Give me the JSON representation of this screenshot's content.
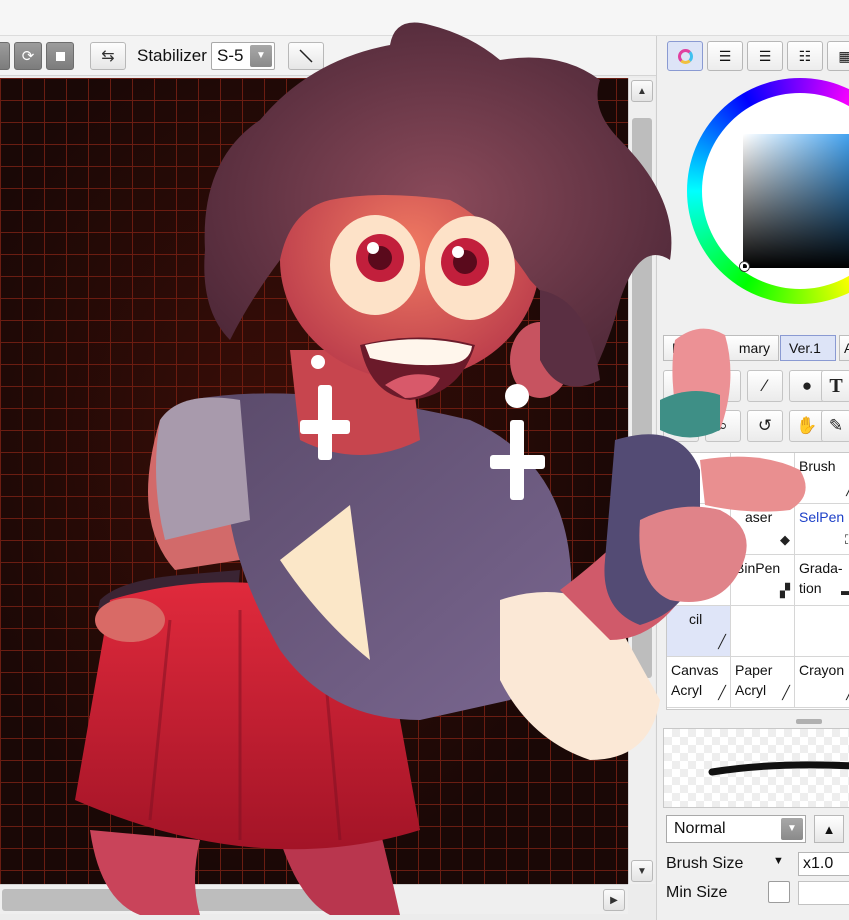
{
  "toolbar": {
    "stabilizer_label": "Stabilizer",
    "stabilizer_value": "S-5"
  },
  "color_panel": {
    "tabs": [
      "color-wheel",
      "sliders",
      "rgb",
      "palette",
      "swatches"
    ]
  },
  "brush_tabs": {
    "items": [
      {
        "label": "B",
        "active": false
      },
      {
        "label": "mary",
        "active": false
      },
      {
        "label": "Ver.1",
        "active": true
      },
      {
        "label": "A",
        "active": false
      }
    ]
  },
  "tools": {
    "icons": [
      "cloud-icon",
      "magic-wand-icon",
      "bucket-icon",
      "text-icon",
      "magnifier-icon",
      "rotate-icon",
      "hand-icon",
      "eyedropper-icon"
    ],
    "text_tool_glyph": "T"
  },
  "brushes": {
    "brush": "Brush",
    "eraser": "aser",
    "selpen": "SelPen",
    "binpen": "BinPen",
    "gradation_1": "Grada-",
    "gradation_2": "tion",
    "pencil": "cil",
    "canvas_1": "Canvas",
    "canvas_2": "Acryl",
    "paper_1": "Paper",
    "paper_2": "Acryl",
    "crayon": "Crayon"
  },
  "brush_settings": {
    "blend_mode": "Normal",
    "brush_size_label": "Brush Size",
    "brush_size_mult": "x1.0",
    "min_size_label": "Min Size"
  },
  "colors": {
    "canvas_bg": "#1a0806",
    "grid": "#6a1d12",
    "accent_tab": "#dde4f7",
    "selpen_text": "#1d40c8"
  }
}
